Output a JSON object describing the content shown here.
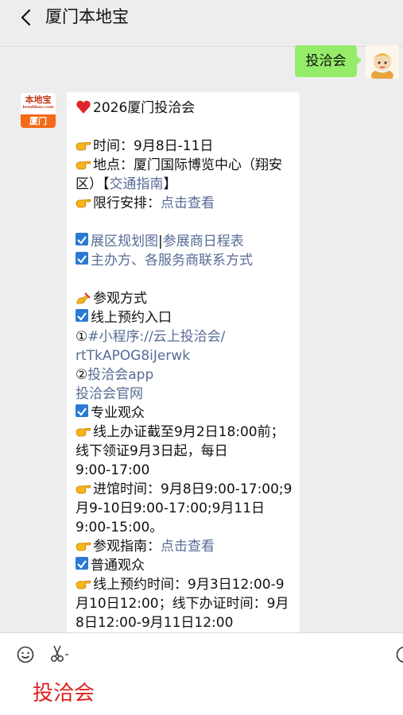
{
  "header": {
    "title": "厦门本地宝"
  },
  "outgoing": {
    "text": "投洽会"
  },
  "incoming": {
    "avatar_top": "本地宝",
    "avatar_sub": "bendibao.com",
    "avatar_bottom": "厦门",
    "lines": {
      "l1": "2026厦门投洽会",
      "l2": "时间：9月8日-11日",
      "l3a": "地点：厦门国际博览中心（翔安",
      "l3b": "区）【",
      "l3link": "交通指南",
      "l3c": "】",
      "l4a": "限行安排：",
      "l4link": "点击查看",
      "l5link1": "展区规划图",
      "l5sep": "|",
      "l5link2": "参展商日程表",
      "l6link": "主办方、各服务商联系方式",
      "l7": "参观方式",
      "l8": "线上预约入口",
      "l9a": "①",
      "l9link1": "#小程序://云上投洽会/",
      "l9link2": "rtTkAPOG8iJerwk",
      "l10a": "②",
      "l10link": "投洽会app",
      "l11link": "投洽会官网",
      "l12": "专业观众",
      "l13a": "线上办证截至9月2日18:00前；",
      "l13b": "线下领证9月3日起，每日",
      "l13c": "9:00-17:00",
      "l14a": "进馆时间：9月8日9:00-17:00;9",
      "l14b": "月9-10日9:00-17:00;9月11日",
      "l14c": "9:00-15:00。",
      "l15a": "参观指南：",
      "l15link": "点击查看",
      "l16": "普通观众",
      "l17a": "线上预约时间：9月3日12:00-9",
      "l17b": "月10日12:00；线下办证时间：9月",
      "l17c": "8日12:00-9月11日12:00"
    }
  },
  "input": {
    "value": "投洽会"
  },
  "icons": {
    "back": "chevron-left-icon",
    "emoji": "smiley-icon",
    "scissors": "scissors-icon",
    "heart": "red-heart-emoji",
    "pointing": "pointing-hand-emoji",
    "writing": "writing-hand-emoji",
    "check": "check-box-emoji"
  },
  "colors": {
    "link": "#576b95",
    "outgoing_bubble": "#95ec69",
    "input_text": "#e01f1f",
    "logo_orange": "#f46a17"
  }
}
